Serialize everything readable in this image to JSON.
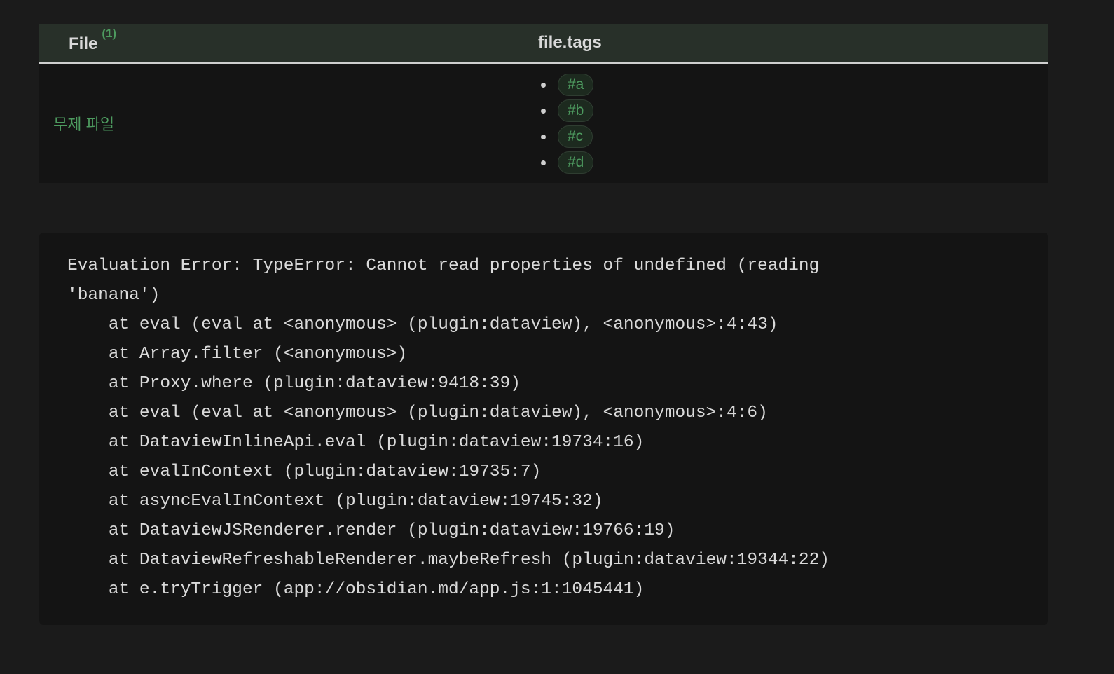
{
  "table": {
    "headers": {
      "file_label": "File",
      "file_count": "(1)",
      "tags_label": "file.tags"
    },
    "rows": [
      {
        "file": "무제 파일",
        "tags": [
          "#a",
          "#b",
          "#c",
          "#d"
        ]
      }
    ]
  },
  "error": {
    "lines": [
      "Evaluation Error: TypeError: Cannot read properties of undefined (reading",
      "'banana')",
      "    at eval (eval at <anonymous> (plugin:dataview), <anonymous>:4:43)",
      "    at Array.filter (<anonymous>)",
      "    at Proxy.where (plugin:dataview:9418:39)",
      "    at eval (eval at <anonymous> (plugin:dataview), <anonymous>:4:6)",
      "    at DataviewInlineApi.eval (plugin:dataview:19734:16)",
      "    at evalInContext (plugin:dataview:19735:7)",
      "    at asyncEvalInContext (plugin:dataview:19745:32)",
      "    at DataviewJSRenderer.render (plugin:dataview:19766:19)",
      "    at DataviewRefreshableRenderer.maybeRefresh (plugin:dataview:19344:22)",
      "    at e.tryTrigger (app://obsidian.md/app.js:1:1045441)"
    ]
  },
  "colors": {
    "background": "#1b1b1b",
    "header_bg": "#283029",
    "accent_green": "#4d9a5f",
    "cell_bg": "#141414"
  }
}
